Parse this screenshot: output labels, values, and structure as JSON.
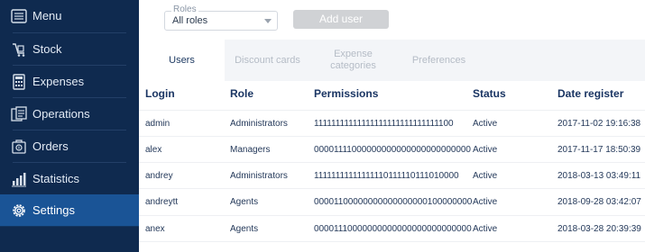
{
  "sidebar": {
    "items": [
      {
        "label": "Menu",
        "icon": "menu-icon"
      },
      {
        "label": "Stock",
        "icon": "stock-icon"
      },
      {
        "label": "Expenses",
        "icon": "calculator-icon"
      },
      {
        "label": "Operations",
        "icon": "operations-icon"
      },
      {
        "label": "Orders",
        "icon": "orders-icon"
      },
      {
        "label": "Statistics",
        "icon": "statistics-icon"
      },
      {
        "label": "Settings",
        "icon": "gear-icon"
      }
    ],
    "active": "Settings"
  },
  "toolbar": {
    "roles_label": "Roles",
    "roles_value": "All roles",
    "add_user_label": "Add user"
  },
  "tabs": [
    {
      "label": "Users"
    },
    {
      "label": "Discount cards"
    },
    {
      "label": "Expense\ncategories"
    },
    {
      "label": "Preferences"
    }
  ],
  "table": {
    "headers": {
      "login": "Login",
      "role": "Role",
      "permissions": "Permissions",
      "status": "Status",
      "date": "Date register"
    },
    "rows": [
      {
        "login": "admin",
        "role": "Administrators",
        "permissions": "11111111111111111111111111111100",
        "status": "Active",
        "date": "2017-11-02 19:16:38"
      },
      {
        "login": "alex",
        "role": "Managers",
        "permissions": "00001111000000000000000000000000",
        "status": "Active",
        "date": "2017-11-17 18:50:39"
      },
      {
        "login": "andrey",
        "role": "Administrators",
        "permissions": "11111111111111110111110111010000",
        "status": "Active",
        "date": "2018-03-13 03:49:11"
      },
      {
        "login": "andreytt",
        "role": "Agents",
        "permissions": "00001100000000000000000100000000",
        "status": "Active",
        "date": "2018-09-28 03:42:07"
      },
      {
        "login": "anex",
        "role": "Agents",
        "permissions": "00001110000000000000000000000000",
        "status": "Active",
        "date": "2018-03-28 20:39:39"
      }
    ]
  },
  "colors": {
    "sidebar_bg": "#0f2a4f",
    "sidebar_active": "#1a5496",
    "header_text": "#1a3563",
    "add_user_disabled": "#d0d2d5"
  }
}
